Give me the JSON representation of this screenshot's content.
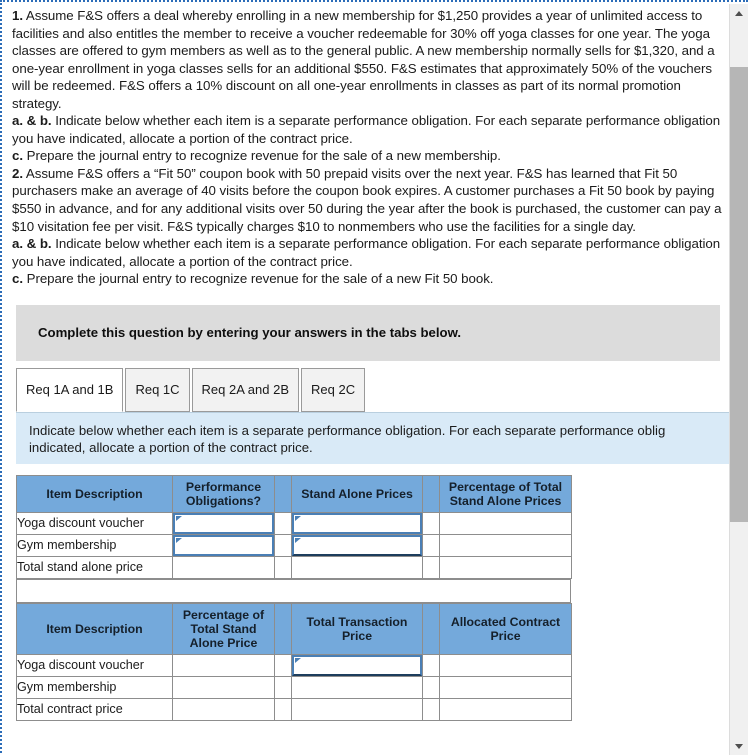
{
  "question": {
    "items": [
      {
        "number": "1.",
        "body": " Assume F&S offers a deal whereby enrolling in a new membership for $1,250 provides a year of unlimited access to facilities and also entitles the member to receive a voucher redeemable for 30% off yoga classes for one year. The yoga classes are offered to gym members as well as to the general public. A new membership normally sells for $1,320, and a one-year enrollment in yoga classes sells for an additional $550. F&S estimates that approximately 50% of the vouchers will be redeemed. F&S offers a 10% discount on all one-year enrollments in classes as part of its normal promotion strategy."
      },
      {
        "number": "a. & b.",
        "body": " Indicate below whether each item is a separate performance obligation. For each separate performance obligation you have indicated, allocate a portion of the contract price."
      },
      {
        "number": "c.",
        "body": " Prepare the journal entry to recognize revenue for the sale of a new membership."
      },
      {
        "number": "2.",
        "body": " Assume F&S offers a “Fit 50” coupon book with 50 prepaid visits over the next year. F&S has learned that Fit 50 purchasers make an average of 40 visits before the coupon book expires. A customer purchases a Fit 50 book by paying $550 in advance, and for any additional visits over 50 during the year after the book is purchased, the customer can pay a $10 visitation fee per visit. F&S typically charges $10 to nonmembers who use the facilities for a single day."
      },
      {
        "number": "a. & b.",
        "body": " Indicate below whether each item is a separate performance obligation. For each separate performance obligation you have indicated, allocate a portion of the contract price."
      },
      {
        "number": "c.",
        "body": " Prepare the journal entry to recognize revenue for the sale of a new Fit 50 book."
      }
    ]
  },
  "banner": {
    "text": "Complete this question by entering your answers in the tabs below."
  },
  "tabs": [
    {
      "label": "Req 1A and 1B",
      "active": true
    },
    {
      "label": "Req 1C",
      "active": false
    },
    {
      "label": "Req 2A and 2B",
      "active": false
    },
    {
      "label": "Req 2C",
      "active": false
    }
  ],
  "instruction": {
    "text": "Indicate below whether each item is a separate performance obligation. For each separate performance oblig\nindicated, allocate a portion of the contract price."
  },
  "tables": [
    {
      "name": "stand-alone-price-table",
      "headers": [
        "Item Description",
        "Performance Obligations?",
        "",
        "Stand Alone Prices",
        "",
        "Percentage of Total Stand Alone Prices"
      ],
      "rows": [
        {
          "label": "Yoga discount voucher",
          "cells": [
            {
              "type": "edit",
              "value": ""
            },
            {
              "type": "spacer",
              "value": ""
            },
            {
              "type": "edit",
              "value": ""
            },
            {
              "type": "spacer",
              "value": ""
            },
            {
              "type": "plain",
              "value": ""
            }
          ]
        },
        {
          "label": "Gym membership",
          "cells": [
            {
              "type": "edit",
              "value": ""
            },
            {
              "type": "spacer",
              "value": ""
            },
            {
              "type": "edit-bold",
              "value": ""
            },
            {
              "type": "spacer",
              "value": ""
            },
            {
              "type": "plain",
              "value": ""
            }
          ]
        },
        {
          "label": "Total stand alone price",
          "cells": [
            {
              "type": "plain",
              "value": ""
            },
            {
              "type": "spacer",
              "value": ""
            },
            {
              "type": "plain",
              "value": ""
            },
            {
              "type": "spacer",
              "value": ""
            },
            {
              "type": "plain",
              "value": ""
            }
          ]
        }
      ]
    },
    {
      "name": "allocated-contract-price-table",
      "headers": [
        "Item Description",
        "Percentage of Total Stand Alone Price",
        "",
        "Total Transaction Price",
        "",
        "Allocated Contract Price"
      ],
      "rows": [
        {
          "label": "Yoga discount voucher",
          "cells": [
            {
              "type": "plain",
              "value": ""
            },
            {
              "type": "spacer",
              "value": ""
            },
            {
              "type": "edit",
              "value": ""
            },
            {
              "type": "spacer",
              "value": ""
            },
            {
              "type": "plain",
              "value": ""
            }
          ]
        },
        {
          "label": "Gym membership",
          "cells": [
            {
              "type": "plain",
              "value": ""
            },
            {
              "type": "spacer",
              "value": ""
            },
            {
              "type": "plain",
              "value": ""
            },
            {
              "type": "spacer",
              "value": ""
            },
            {
              "type": "plain",
              "value": ""
            }
          ]
        },
        {
          "label": "Total contract price",
          "cells": [
            {
              "type": "plain",
              "value": ""
            },
            {
              "type": "spacer",
              "value": ""
            },
            {
              "type": "plain",
              "value": ""
            },
            {
              "type": "spacer",
              "value": ""
            },
            {
              "type": "plain",
              "value": ""
            }
          ]
        }
      ]
    }
  ],
  "colors": {
    "table_header": "#74a9db",
    "instruction_bg": "#d9eaf7",
    "banner_bg": "#dcdcdc",
    "selection_border": "#2b6cb8",
    "active_cell_border": "#4a7fb5"
  },
  "scrollbar": {
    "up_icon": "triangle-up-icon",
    "down_icon": "triangle-down-icon"
  }
}
